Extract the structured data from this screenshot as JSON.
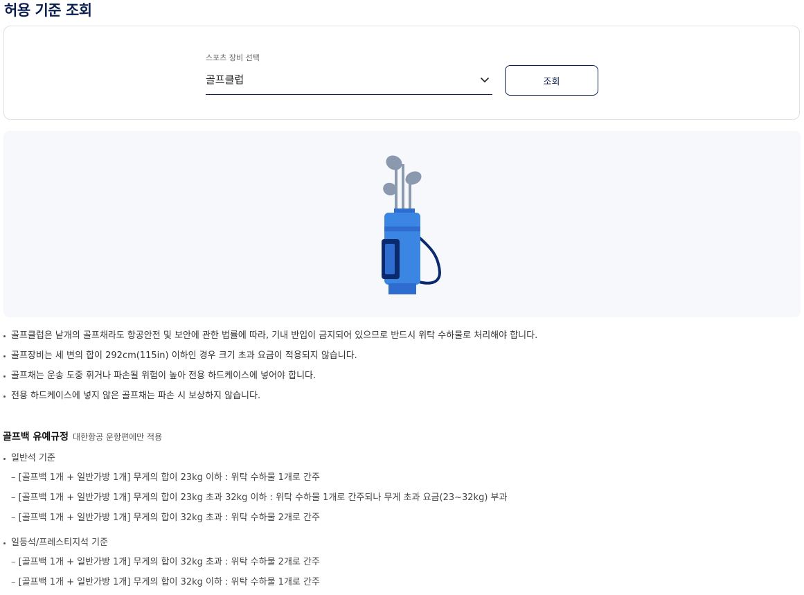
{
  "page": {
    "title": "허용 기준 조회"
  },
  "search": {
    "select_label": "스포츠 장비 선택",
    "selected_value": "골프클럽",
    "button_label": "조회"
  },
  "illustration": {
    "icon": "golf-bag-icon",
    "colors": {
      "bag": "#3c86e3",
      "bag_dark": "#2f6cd0",
      "pocket": "#0b2a6e",
      "clubs": "#8a99ad"
    }
  },
  "notices": [
    "골프클럽은 낱개의 골프채라도 항공안전 및 보안에 관한 법률에 따라, 기내 반입이 금지되어 있으므로 반드시 위탁 수하물로 처리해야 합니다.",
    "골프장비는 세 변의 합이 292cm(115in) 이하인 경우 크기 초과 요금이 적용되지 않습니다.",
    "골프채는 운송 도중 휘거나 파손될 위험이 높아 전용 하드케이스에 넣어야 합니다.",
    "전용 하드케이스에 넣지 않은 골프채는 파손 시 보상하지 않습니다."
  ],
  "golf_bag_rules": {
    "title": "골프백 유예규정",
    "note": "대한항공 운항편에만 적용",
    "groups": [
      {
        "label": "일반석 기준",
        "items": [
          "[골프백 1개 + 일반가방 1개] 무게의 합이 23kg 이하 : 위탁 수하물 1개로 간주",
          "[골프백 1개 + 일반가방 1개] 무게의 합이 23kg 초과 32kg 이하 : 위탁 수하물 1개로 간주되나 무게 초과 요금(23~32kg) 부과",
          "[골프백 1개 + 일반가방 1개] 무게의 합이 32kg 초과 : 위탁 수하물 2개로 간주"
        ]
      },
      {
        "label": "일등석/프레스티지석 기준",
        "items": [
          "[골프백 1개 + 일반가방 1개] 무게의 합이 32kg 초과 : 위탁 수하물 2개로 간주",
          "[골프백 1개 + 일반가방 1개] 무게의 합이 32kg 이하 : 위탁 수하물 1개로 간주"
        ]
      }
    ]
  }
}
